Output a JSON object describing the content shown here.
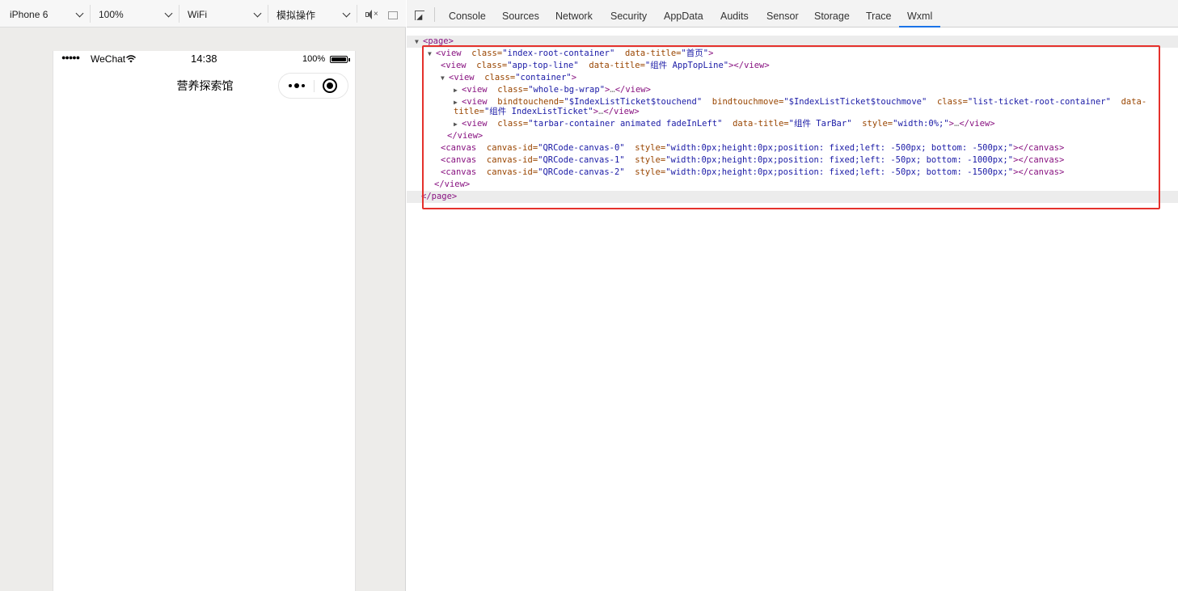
{
  "sim_toolbar": {
    "device": "iPhone 6",
    "zoom": "100%",
    "network": "WiFi",
    "operation": "模拟操作"
  },
  "phone": {
    "signal": "●●●●●",
    "carrier": "WeChat",
    "time": "14:38",
    "battery": "100%",
    "nav_title": "营养探索馆"
  },
  "devtools": {
    "tabs": [
      "Console",
      "Sources",
      "Network",
      "Security",
      "AppData",
      "Audits",
      "Sensor",
      "Storage",
      "Trace",
      "Wxml"
    ],
    "active_tab": "Wxml"
  },
  "wxml": {
    "l0": {
      "open": "<page>"
    },
    "l1": {
      "tag": "<view",
      "a1": "class=",
      "v1": "\"index-root-container\"",
      "a2": "data-title=",
      "v2": "\"首页\"",
      "close": ">"
    },
    "l2": {
      "tag": "<view",
      "a1": "class=",
      "v1": "\"app-top-line\"",
      "a2": "data-title=",
      "v2": "\"组件 AppTopLine\"",
      "close": "></view>"
    },
    "l3": {
      "tag": "<view",
      "a1": "class=",
      "v1": "\"container\"",
      "close": ">"
    },
    "l4": {
      "tag": "<view",
      "a1": "class=",
      "v1": "\"whole-bg-wrap\"",
      "open": ">",
      "ell": "…",
      "close": "</view>"
    },
    "l5": {
      "tag": "<view",
      "a1": "bindtouchend=",
      "v1": "\"$IndexListTicket$touchend\"",
      "a2": "bindtouchmove=",
      "v2": "\"$IndexListTicket$touchmove\"",
      "a3": "class=",
      "v3": "\"list-ticket-root-container\"",
      "a4": "data-"
    },
    "l5b": {
      "a4": "title=",
      "v4": "\"组件 IndexListTicket\"",
      "open": ">",
      "ell": "…",
      "close": "</view>"
    },
    "l6": {
      "tag": "<view",
      "a1": "class=",
      "v1": "\"tarbar-container animated fadeInLeft\"",
      "a2": "data-title=",
      "v2": "\"组件 TarBar\"",
      "a3": "style=",
      "v3": "\"width:0%;\"",
      "open": ">",
      "ell": "…",
      "close": "</view>"
    },
    "l7": {
      "close": "</view>"
    },
    "l8": {
      "tag": "<canvas",
      "a1": "canvas-id=",
      "v1": "\"QRCode-canvas-0\"",
      "a2": "style=",
      "v2": "\"width:0px;height:0px;position: fixed;left: -500px; bottom: -500px;\"",
      "close": "></canvas>"
    },
    "l9": {
      "tag": "<canvas",
      "a1": "canvas-id=",
      "v1": "\"QRCode-canvas-1\"",
      "a2": "style=",
      "v2": "\"width:0px;height:0px;position: fixed;left: -50px; bottom: -1000px;\"",
      "close": "></canvas>"
    },
    "l10": {
      "tag": "<canvas",
      "a1": "canvas-id=",
      "v1": "\"QRCode-canvas-2\"",
      "a2": "style=",
      "v2": "\"width:0px;height:0px;position: fixed;left: -50px; bottom: -1500px;\"",
      "close": "></canvas>"
    },
    "l11": {
      "close": "</view>"
    },
    "l12": {
      "close": "</page>"
    }
  },
  "colors": {
    "highlight_border": "#e5312c",
    "active_tab_underline": "#1a73e8",
    "tag": "#881280",
    "attr_name": "#994500",
    "attr_value": "#1a1aa6"
  }
}
